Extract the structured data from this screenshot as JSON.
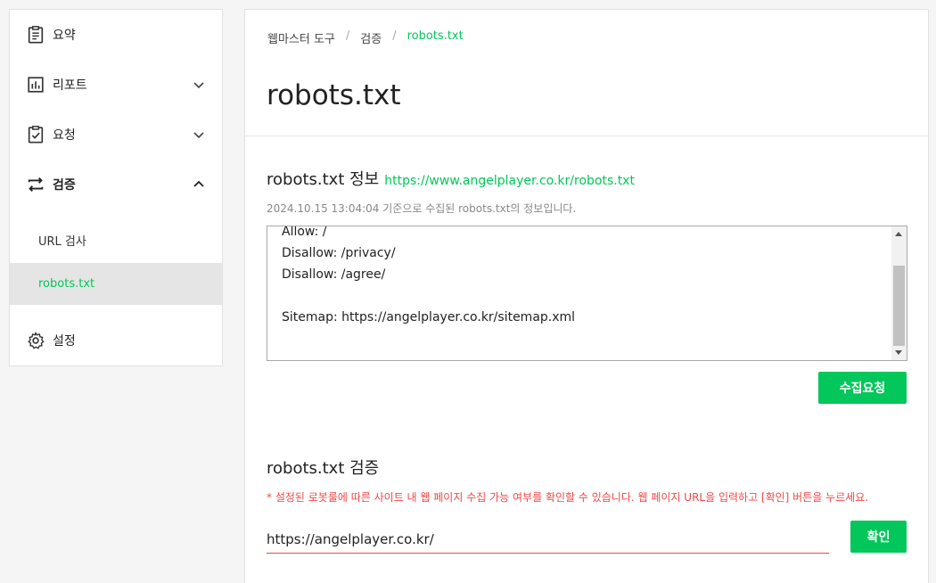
{
  "sidebar": {
    "summary": {
      "label": "요약",
      "icon": "clipboard-icon"
    },
    "report": {
      "label": "리포트",
      "icon": "bar-chart-icon"
    },
    "request": {
      "label": "요청",
      "icon": "clipboard-check-icon"
    },
    "verify": {
      "label": "검증",
      "icon": "swap-arrows-icon"
    },
    "sub_items": [
      {
        "label": "URL 검사",
        "active": false
      },
      {
        "label": "robots.txt",
        "active": true
      }
    ],
    "settings": {
      "label": "설정",
      "icon": "gear-icon"
    }
  },
  "breadcrumb": [
    "웹마스터 도구",
    "검증",
    "robots.txt"
  ],
  "page_title": "robots.txt",
  "info_section": {
    "title": "robots.txt 정보",
    "url": "https://www.angelplayer.co.kr/robots.txt",
    "note": "2024.10.15 13:04:04 기준으로 수집된 robots.txt의 정보입니다.",
    "content_lines": [
      "Allow: /",
      "Disallow: /privacy/",
      "Disallow: /agree/",
      "",
      "Sitemap: https://angelplayer.co.kr/sitemap.xml"
    ],
    "collect_button": "수집요청"
  },
  "verify_section": {
    "title": "robots.txt 검증",
    "warning": "* 설정된 로봇룰에 따른 사이트 내 웹 페이지 수집 가능 여부를 확인할 수 있습니다. 웹 페이지 URL을 입력하고 [확인] 버튼을 누르세요.",
    "url_value": "https://angelplayer.co.kr/",
    "confirm_button": "확인"
  },
  "colors": {
    "accent": "#03c75a",
    "warning": "#f04848"
  }
}
